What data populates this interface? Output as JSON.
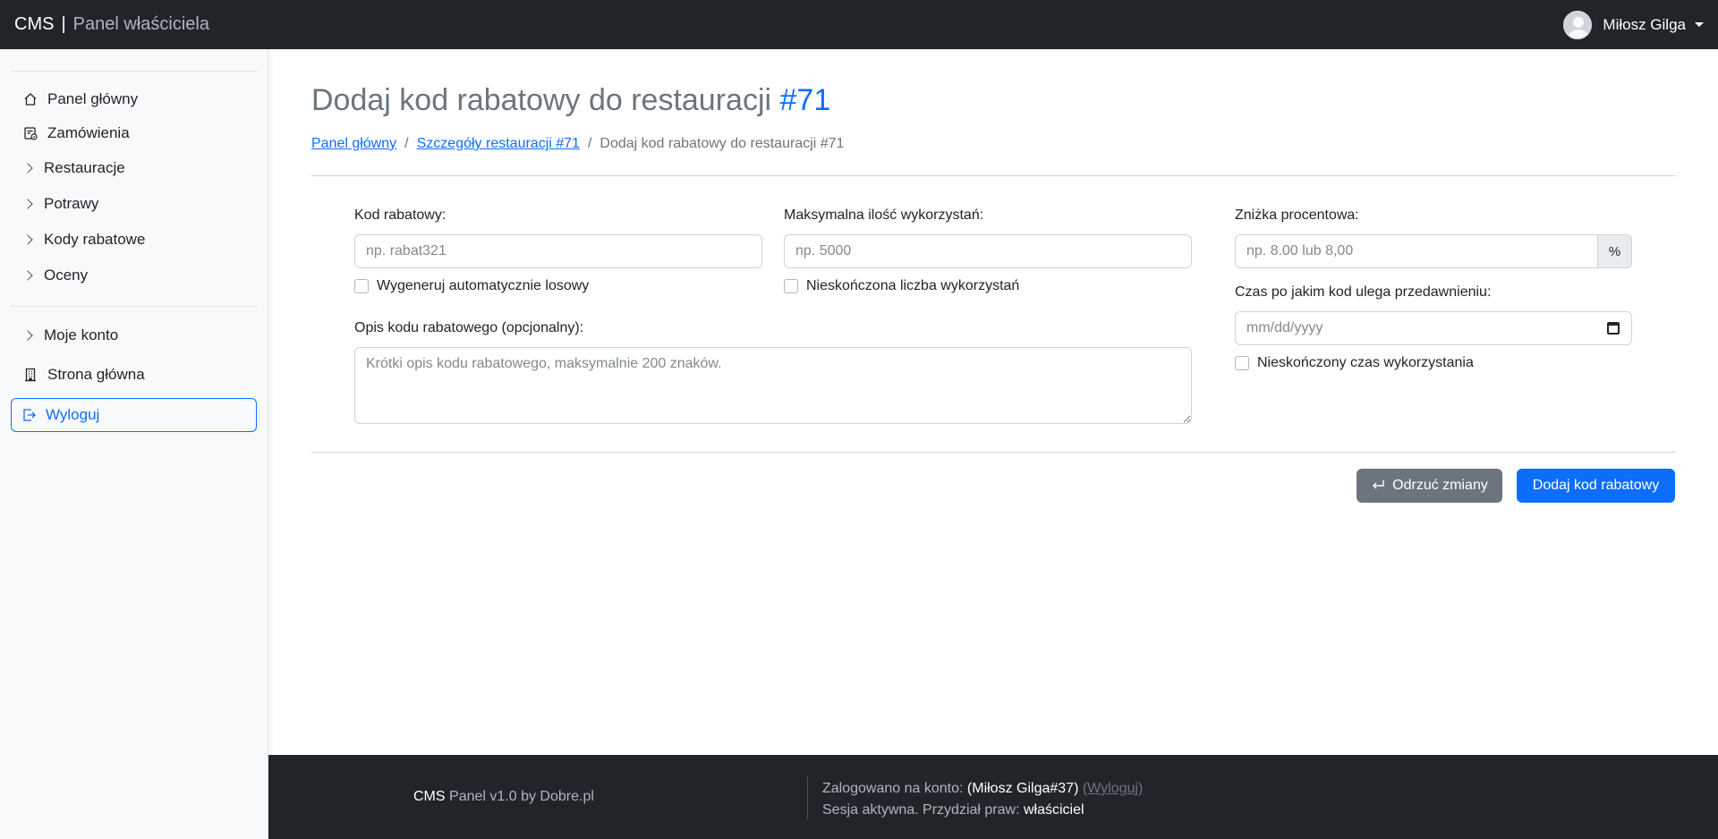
{
  "header": {
    "brand": "CMS",
    "separator": "|",
    "subtitle": "Panel właściciela",
    "user_name": "Miłosz Gilga"
  },
  "sidebar": {
    "items": [
      {
        "label": "Panel główny",
        "icon": "home-icon"
      },
      {
        "label": "Zamówienia",
        "icon": "orders-icon"
      },
      {
        "label": "Restauracje",
        "icon": "chevron-right-icon"
      },
      {
        "label": "Potrawy",
        "icon": "chevron-right-icon"
      },
      {
        "label": "Kody rabatowe",
        "icon": "chevron-right-icon"
      },
      {
        "label": "Oceny",
        "icon": "chevron-right-icon"
      },
      {
        "label": "Moje konto",
        "icon": "chevron-right-icon"
      },
      {
        "label": "Strona główna",
        "icon": "building-icon"
      }
    ],
    "logout_label": "Wyloguj"
  },
  "main": {
    "title": "Dodaj kod rabatowy do restauracji",
    "title_hash": "#71",
    "breadcrumb": {
      "home": "Panel główny",
      "divider": "/",
      "details": "Szczegóły restauracji #71",
      "current": "Dodaj kod rabatowy do restauracji #71"
    },
    "form": {
      "code_label": "Kod rabatowy:",
      "code_placeholder": "np. rabat321",
      "code_random_label": "Wygeneruj automatycznie losowy",
      "max_uses_label": "Maksymalna ilość wykorzystań:",
      "max_uses_placeholder": "np. 5000",
      "infinite_uses_label": "Nieskończona liczba wykorzystań",
      "discount_label": "Zniżka procentowa:",
      "discount_placeholder": "np. 8.00 lub 8,00",
      "discount_addon": "%",
      "expiry_label": "Czas po jakim kod ulega przedawnieniu:",
      "expiry_placeholder": "mm/dd/yyyy",
      "infinite_time_label": "Nieskończony czas wykorzystania",
      "description_label": "Opis kodu rabatowego (opcjonalny):",
      "description_placeholder": "Krótki opis kodu rabatowego, maksymalnie 200 znaków."
    },
    "buttons": {
      "discard": "Odrzuć zmiany",
      "submit": "Dodaj kod rabatowy"
    }
  },
  "footer": {
    "brand": "CMS",
    "version": "Panel v1.0 by Dobre.pl",
    "logged_in_prefix": "Zalogowano na konto:",
    "logged_in_user": "(Miłosz Gilga#37)",
    "logout_link": "(Wyloguj)",
    "session_prefix": "Sesja aktywna. Przydział praw:",
    "role": "właściciel"
  },
  "colors": {
    "dark": "#212529",
    "primary": "#0d6efd",
    "secondary": "#6c757d",
    "sidebar_bg": "#f8f9fa"
  }
}
